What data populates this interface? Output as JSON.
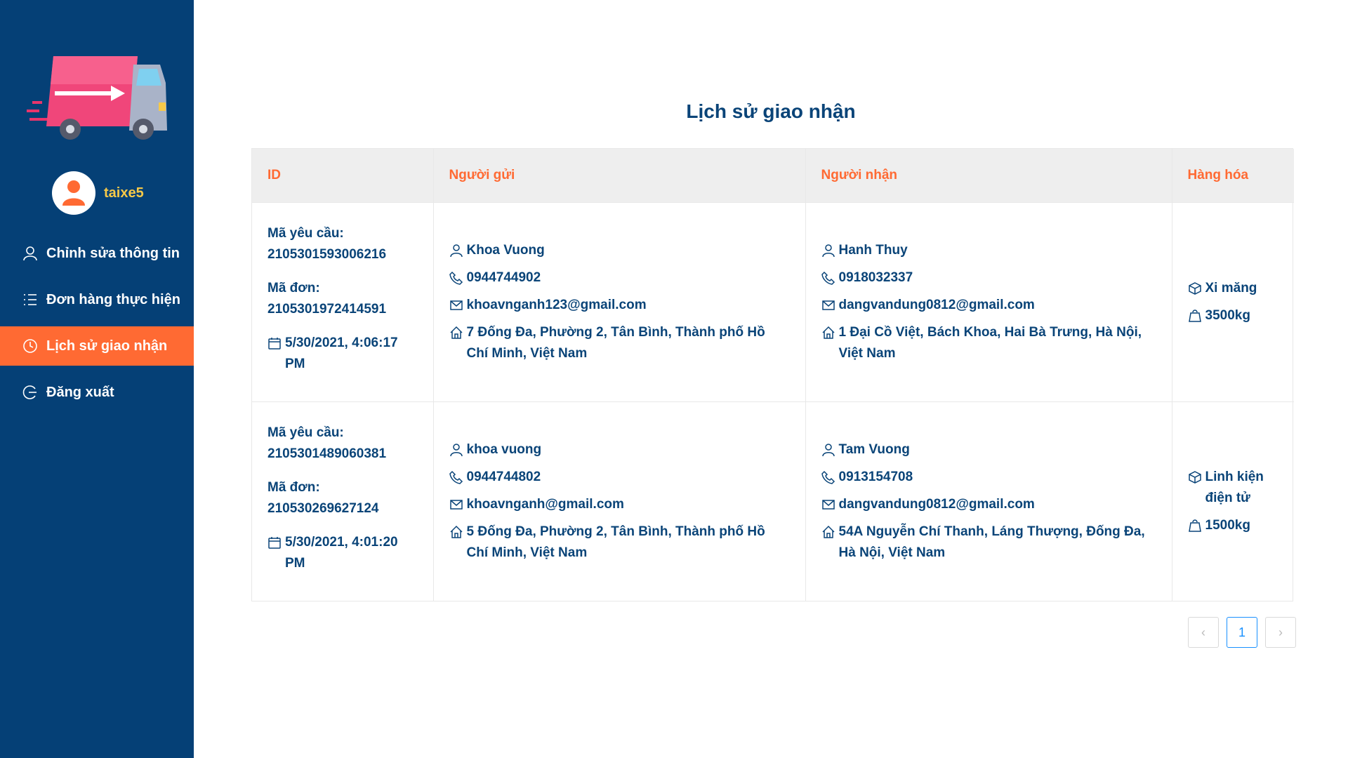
{
  "user": {
    "name": "taixe5"
  },
  "menu": [
    {
      "label": "Chỉnh sửa thông tin",
      "icon": "user-icon",
      "active": false
    },
    {
      "label": "Đơn hàng thực hiện",
      "icon": "list-icon",
      "active": false
    },
    {
      "label": "Lịch sử giao nhận",
      "icon": "clock-icon",
      "active": true
    },
    {
      "label": "Đăng xuất",
      "icon": "logout-icon",
      "active": false
    }
  ],
  "page": {
    "title": "Lịch sử giao nhận"
  },
  "table": {
    "headers": {
      "id": "ID",
      "sender": "Người gửi",
      "receiver": "Người nhận",
      "goods": "Hàng hóa"
    },
    "rows": [
      {
        "request_label": "Mã yêu cầu:",
        "request_id": "2105301593006216",
        "order_label": "Mã đơn:",
        "order_id": "2105301972414591",
        "date": "5/30/2021, 4:06:17 PM",
        "sender": {
          "name": "Khoa Vuong",
          "phone": "0944744902",
          "email": "khoavnganh123@gmail.com",
          "address": "7 Đống Đa, Phường 2, Tân Bình, Thành phố Hồ Chí Minh, Việt Nam"
        },
        "receiver": {
          "name": "Hanh Thuy",
          "phone": "0918032337",
          "email": "dangvandung0812@gmail.com",
          "address": "1 Đại Cồ Việt, Bách Khoa, Hai Bà Trưng, Hà Nội, Việt Nam"
        },
        "goods": {
          "type": "Xi măng",
          "weight": "3500kg"
        }
      },
      {
        "request_label": "Mã yêu cầu:",
        "request_id": "2105301489060381",
        "order_label": "Mã đơn:",
        "order_id": "210530269627124",
        "date": "5/30/2021, 4:01:20 PM",
        "sender": {
          "name": "khoa vuong",
          "phone": "0944744802",
          "email": "khoavnganh@gmail.com",
          "address": "5 Đống Đa, Phường 2, Tân Bình, Thành phố Hồ Chí Minh, Việt Nam"
        },
        "receiver": {
          "name": "Tam Vuong",
          "phone": "0913154708",
          "email": "dangvandung0812@gmail.com",
          "address": "54A Nguyễn Chí Thanh, Láng Thượng, Đống Đa, Hà Nội, Việt Nam"
        },
        "goods": {
          "type": "Linh kiện điện tử",
          "weight": "1500kg"
        }
      }
    ]
  },
  "pagination": {
    "current": "1",
    "prev": "‹",
    "next": "›"
  },
  "colors": {
    "sidebar": "#054076",
    "accent": "#ff6a33",
    "username": "#f7c948",
    "text": "#0a4478",
    "pager_active": "#1890ff"
  }
}
